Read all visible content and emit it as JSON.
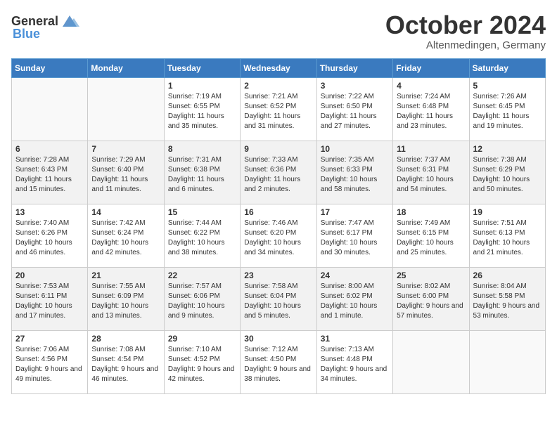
{
  "header": {
    "logo_general": "General",
    "logo_blue": "Blue",
    "month": "October 2024",
    "location": "Altenmedingen, Germany"
  },
  "days_of_week": [
    "Sunday",
    "Monday",
    "Tuesday",
    "Wednesday",
    "Thursday",
    "Friday",
    "Saturday"
  ],
  "weeks": [
    [
      {
        "day": "",
        "empty": true
      },
      {
        "day": "",
        "empty": true
      },
      {
        "day": "1",
        "sunrise": "Sunrise: 7:19 AM",
        "sunset": "Sunset: 6:55 PM",
        "daylight": "Daylight: 11 hours and 35 minutes."
      },
      {
        "day": "2",
        "sunrise": "Sunrise: 7:21 AM",
        "sunset": "Sunset: 6:52 PM",
        "daylight": "Daylight: 11 hours and 31 minutes."
      },
      {
        "day": "3",
        "sunrise": "Sunrise: 7:22 AM",
        "sunset": "Sunset: 6:50 PM",
        "daylight": "Daylight: 11 hours and 27 minutes."
      },
      {
        "day": "4",
        "sunrise": "Sunrise: 7:24 AM",
        "sunset": "Sunset: 6:48 PM",
        "daylight": "Daylight: 11 hours and 23 minutes."
      },
      {
        "day": "5",
        "sunrise": "Sunrise: 7:26 AM",
        "sunset": "Sunset: 6:45 PM",
        "daylight": "Daylight: 11 hours and 19 minutes."
      }
    ],
    [
      {
        "day": "6",
        "sunrise": "Sunrise: 7:28 AM",
        "sunset": "Sunset: 6:43 PM",
        "daylight": "Daylight: 11 hours and 15 minutes."
      },
      {
        "day": "7",
        "sunrise": "Sunrise: 7:29 AM",
        "sunset": "Sunset: 6:40 PM",
        "daylight": "Daylight: 11 hours and 11 minutes."
      },
      {
        "day": "8",
        "sunrise": "Sunrise: 7:31 AM",
        "sunset": "Sunset: 6:38 PM",
        "daylight": "Daylight: 11 hours and 6 minutes."
      },
      {
        "day": "9",
        "sunrise": "Sunrise: 7:33 AM",
        "sunset": "Sunset: 6:36 PM",
        "daylight": "Daylight: 11 hours and 2 minutes."
      },
      {
        "day": "10",
        "sunrise": "Sunrise: 7:35 AM",
        "sunset": "Sunset: 6:33 PM",
        "daylight": "Daylight: 10 hours and 58 minutes."
      },
      {
        "day": "11",
        "sunrise": "Sunrise: 7:37 AM",
        "sunset": "Sunset: 6:31 PM",
        "daylight": "Daylight: 10 hours and 54 minutes."
      },
      {
        "day": "12",
        "sunrise": "Sunrise: 7:38 AM",
        "sunset": "Sunset: 6:29 PM",
        "daylight": "Daylight: 10 hours and 50 minutes."
      }
    ],
    [
      {
        "day": "13",
        "sunrise": "Sunrise: 7:40 AM",
        "sunset": "Sunset: 6:26 PM",
        "daylight": "Daylight: 10 hours and 46 minutes."
      },
      {
        "day": "14",
        "sunrise": "Sunrise: 7:42 AM",
        "sunset": "Sunset: 6:24 PM",
        "daylight": "Daylight: 10 hours and 42 minutes."
      },
      {
        "day": "15",
        "sunrise": "Sunrise: 7:44 AM",
        "sunset": "Sunset: 6:22 PM",
        "daylight": "Daylight: 10 hours and 38 minutes."
      },
      {
        "day": "16",
        "sunrise": "Sunrise: 7:46 AM",
        "sunset": "Sunset: 6:20 PM",
        "daylight": "Daylight: 10 hours and 34 minutes."
      },
      {
        "day": "17",
        "sunrise": "Sunrise: 7:47 AM",
        "sunset": "Sunset: 6:17 PM",
        "daylight": "Daylight: 10 hours and 30 minutes."
      },
      {
        "day": "18",
        "sunrise": "Sunrise: 7:49 AM",
        "sunset": "Sunset: 6:15 PM",
        "daylight": "Daylight: 10 hours and 25 minutes."
      },
      {
        "day": "19",
        "sunrise": "Sunrise: 7:51 AM",
        "sunset": "Sunset: 6:13 PM",
        "daylight": "Daylight: 10 hours and 21 minutes."
      }
    ],
    [
      {
        "day": "20",
        "sunrise": "Sunrise: 7:53 AM",
        "sunset": "Sunset: 6:11 PM",
        "daylight": "Daylight: 10 hours and 17 minutes."
      },
      {
        "day": "21",
        "sunrise": "Sunrise: 7:55 AM",
        "sunset": "Sunset: 6:09 PM",
        "daylight": "Daylight: 10 hours and 13 minutes."
      },
      {
        "day": "22",
        "sunrise": "Sunrise: 7:57 AM",
        "sunset": "Sunset: 6:06 PM",
        "daylight": "Daylight: 10 hours and 9 minutes."
      },
      {
        "day": "23",
        "sunrise": "Sunrise: 7:58 AM",
        "sunset": "Sunset: 6:04 PM",
        "daylight": "Daylight: 10 hours and 5 minutes."
      },
      {
        "day": "24",
        "sunrise": "Sunrise: 8:00 AM",
        "sunset": "Sunset: 6:02 PM",
        "daylight": "Daylight: 10 hours and 1 minute."
      },
      {
        "day": "25",
        "sunrise": "Sunrise: 8:02 AM",
        "sunset": "Sunset: 6:00 PM",
        "daylight": "Daylight: 9 hours and 57 minutes."
      },
      {
        "day": "26",
        "sunrise": "Sunrise: 8:04 AM",
        "sunset": "Sunset: 5:58 PM",
        "daylight": "Daylight: 9 hours and 53 minutes."
      }
    ],
    [
      {
        "day": "27",
        "sunrise": "Sunrise: 7:06 AM",
        "sunset": "Sunset: 4:56 PM",
        "daylight": "Daylight: 9 hours and 49 minutes."
      },
      {
        "day": "28",
        "sunrise": "Sunrise: 7:08 AM",
        "sunset": "Sunset: 4:54 PM",
        "daylight": "Daylight: 9 hours and 46 minutes."
      },
      {
        "day": "29",
        "sunrise": "Sunrise: 7:10 AM",
        "sunset": "Sunset: 4:52 PM",
        "daylight": "Daylight: 9 hours and 42 minutes."
      },
      {
        "day": "30",
        "sunrise": "Sunrise: 7:12 AM",
        "sunset": "Sunset: 4:50 PM",
        "daylight": "Daylight: 9 hours and 38 minutes."
      },
      {
        "day": "31",
        "sunrise": "Sunrise: 7:13 AM",
        "sunset": "Sunset: 4:48 PM",
        "daylight": "Daylight: 9 hours and 34 minutes."
      },
      {
        "day": "",
        "empty": true
      },
      {
        "day": "",
        "empty": true
      }
    ]
  ]
}
